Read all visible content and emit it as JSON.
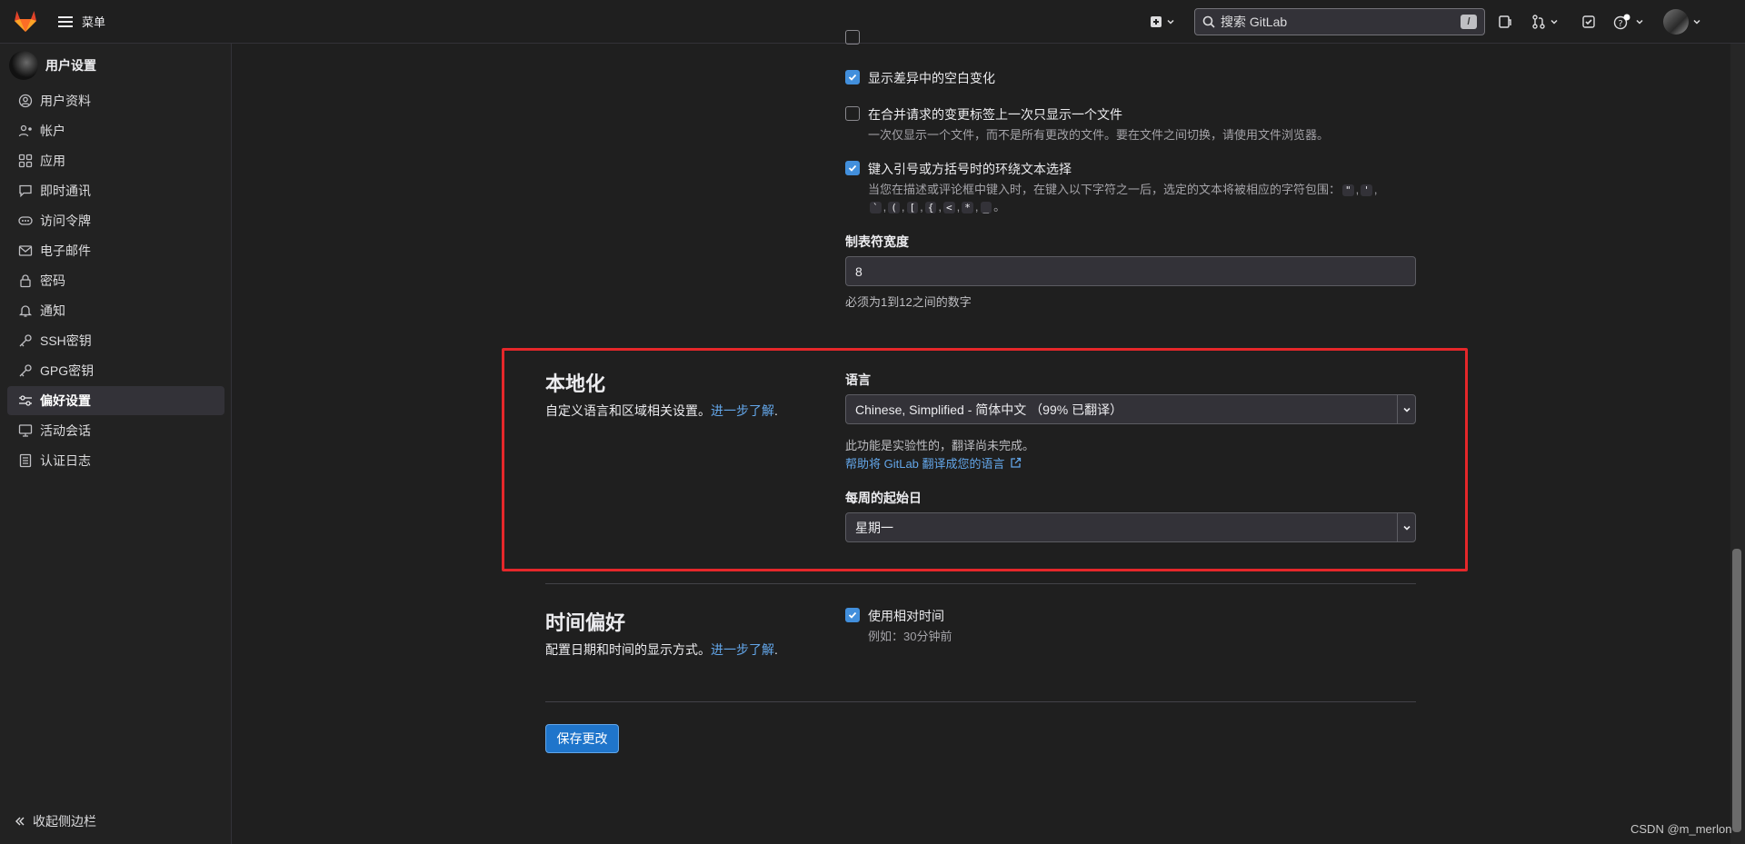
{
  "topbar": {
    "menu_label": "菜单",
    "search_placeholder": "搜索 GitLab",
    "search_shortcut": "/"
  },
  "sidebar": {
    "title": "用户设置",
    "items": [
      {
        "label": "用户资料",
        "icon": "user-icon"
      },
      {
        "label": "帐户",
        "icon": "account-icon"
      },
      {
        "label": "应用",
        "icon": "applications-icon"
      },
      {
        "label": "即时通讯",
        "icon": "chat-icon"
      },
      {
        "label": "访问令牌",
        "icon": "token-icon"
      },
      {
        "label": "电子邮件",
        "icon": "mail-icon"
      },
      {
        "label": "密码",
        "icon": "lock-icon"
      },
      {
        "label": "通知",
        "icon": "bell-icon"
      },
      {
        "label": "SSH密钥",
        "icon": "key-icon"
      },
      {
        "label": "GPG密钥",
        "icon": "key-icon"
      },
      {
        "label": "偏好设置",
        "icon": "preferences-icon",
        "active": true
      },
      {
        "label": "活动会话",
        "icon": "monitor-icon"
      },
      {
        "label": "认证日志",
        "icon": "log-icon"
      }
    ],
    "collapse_label": "收起侧边栏"
  },
  "behavior": {
    "whitespace_label": "显示差异中的空白变化",
    "single_file_label": "在合并请求的变更标签上一次只显示一个文件",
    "single_file_help": "一次仅显示一个文件，而不是所有更改的文件。要在文件之间切换，请使用文件浏览器。",
    "surround_label": "键入引号或方括号时的环绕文本选择",
    "surround_help": "当您在描述或评论框中键入时，在键入以下字符之一后，选定的文本将被相应的字符包围：",
    "surround_chars": [
      "\"",
      "'",
      "`",
      "(",
      "[",
      "{",
      "<",
      "*",
      "_"
    ],
    "tab_width_label": "制表符宽度",
    "tab_width_value": "8",
    "tab_width_help": "必须为1到12之间的数字"
  },
  "localization": {
    "title": "本地化",
    "description": "自定义语言和区域相关设置。",
    "learn_more": "进一步了解",
    "language_label": "语言",
    "language_value": "Chinese, Simplified - 简体中文 （99% 已翻译）",
    "experimental_note": "此功能是实验性的，翻译尚未完成。",
    "help_translate": "帮助将 GitLab 翻译成您的语言",
    "first_day_label": "每周的起始日",
    "first_day_value": "星期一"
  },
  "time_prefs": {
    "title": "时间偏好",
    "description": "配置日期和时间的显示方式。",
    "learn_more": "进一步了解",
    "relative_label": "使用相对时间",
    "relative_help": "例如：30分钟前"
  },
  "save_label": "保存更改",
  "watermark": "CSDN @m_merlon",
  "colors": {
    "accent": "#428fdc",
    "highlight": "#e5272a",
    "link": "#63a6e9"
  }
}
